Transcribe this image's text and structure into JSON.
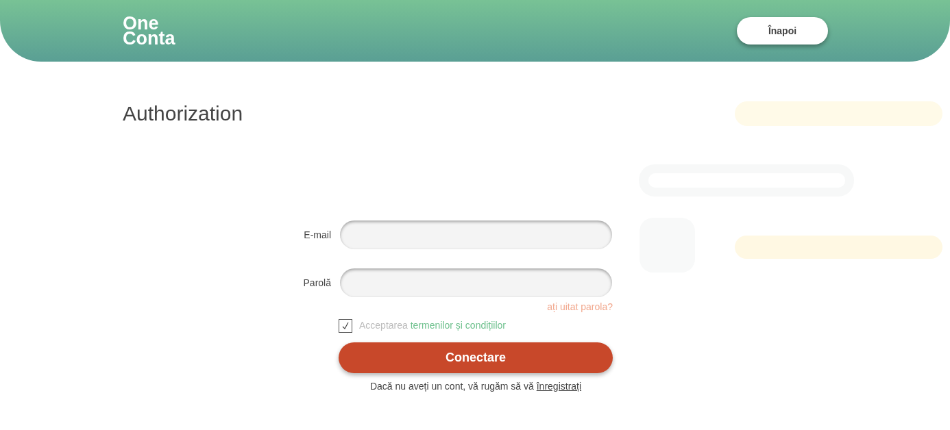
{
  "header": {
    "logo": [
      "One",
      "Conta"
    ],
    "back_button": "Înapoi"
  },
  "title": "Authorization",
  "form": {
    "fields": [
      {
        "label": "E-mail"
      },
      {
        "label": "Parolă"
      }
    ],
    "forgot_link": "ați uitat parola?",
    "terms": {
      "checked": true,
      "text": "Acceptarea",
      "link": "termenilor și condițiilor"
    },
    "submit": "Conectare",
    "register": {
      "text": "Dacă nu aveți un cont, vă rugăm să vă",
      "link": "înregistrați"
    }
  }
}
